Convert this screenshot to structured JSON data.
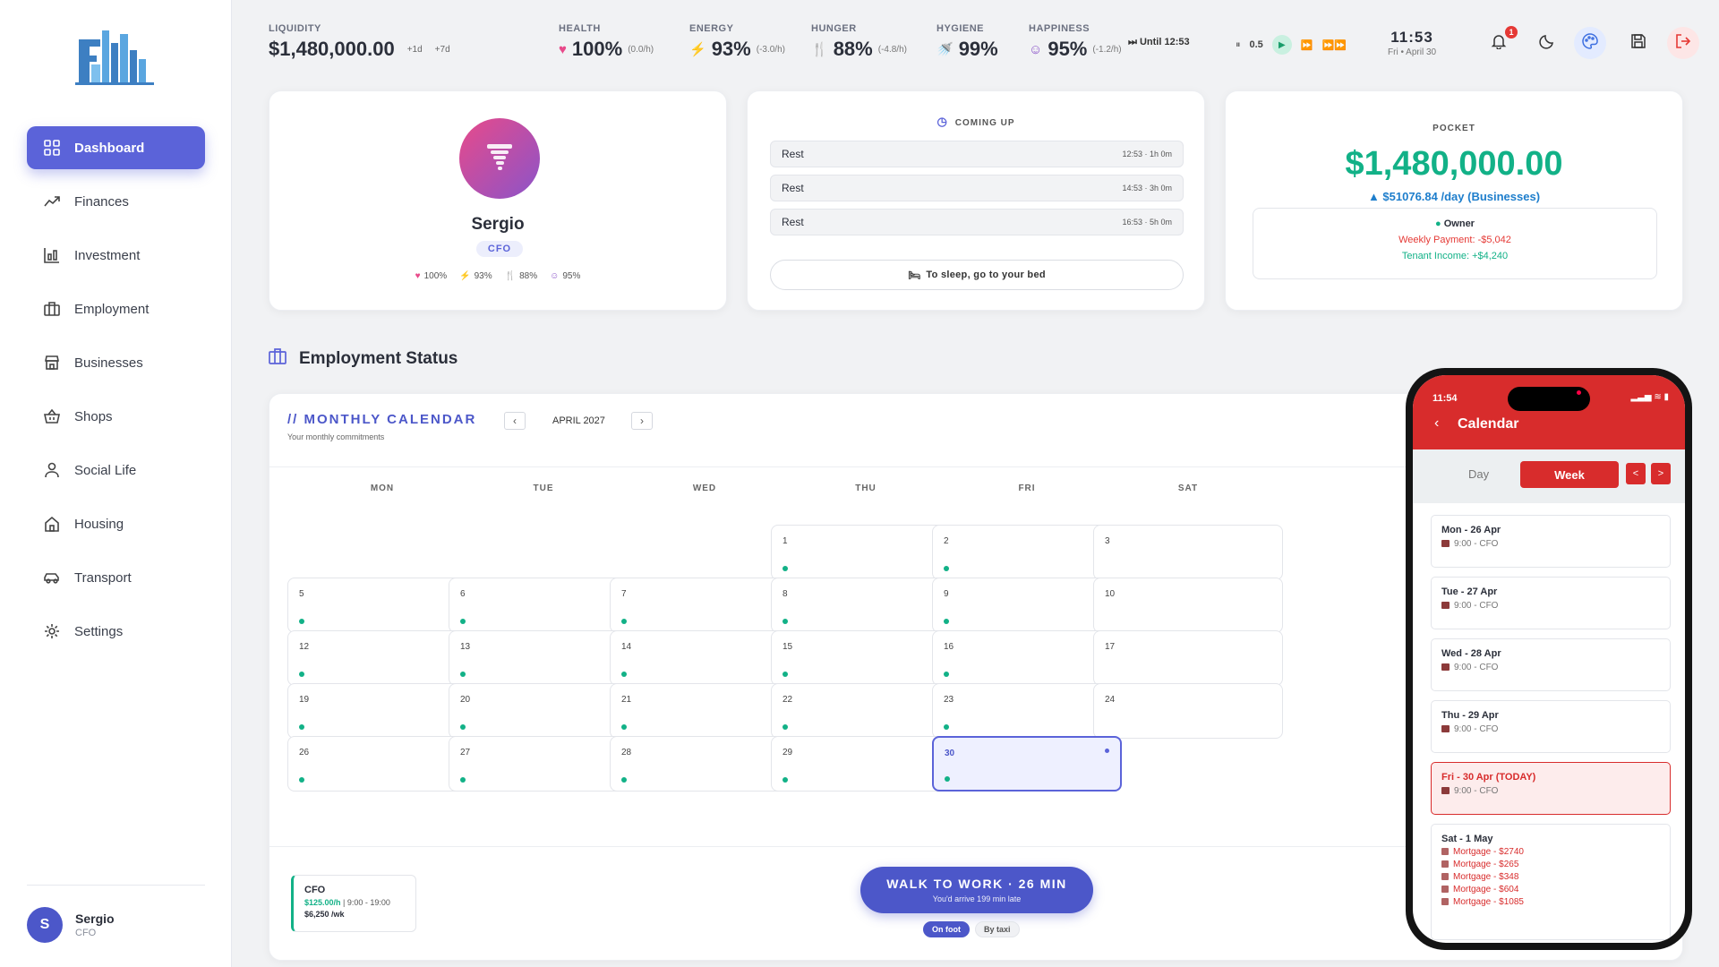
{
  "sidebar": {
    "items": [
      {
        "label": "Dashboard",
        "icon": "grid-icon"
      },
      {
        "label": "Finances",
        "icon": "trend-icon"
      },
      {
        "label": "Investment",
        "icon": "chart-icon"
      },
      {
        "label": "Employment",
        "icon": "briefcase-icon"
      },
      {
        "label": "Businesses",
        "icon": "store-icon"
      },
      {
        "label": "Shops",
        "icon": "basket-icon"
      },
      {
        "label": "Social Life",
        "icon": "person-icon"
      },
      {
        "label": "Housing",
        "icon": "home-icon"
      },
      {
        "label": "Transport",
        "icon": "car-icon"
      },
      {
        "label": "Settings",
        "icon": "gear-icon"
      }
    ],
    "user": {
      "initial": "S",
      "name": "Sergio",
      "role": "CFO"
    }
  },
  "topbar": {
    "liquidity": {
      "label": "LIQUIDITY",
      "value": "$1,480,000.00",
      "chip1": "+1d",
      "chip2": "+7d"
    },
    "health": {
      "label": "HEALTH",
      "value": "100%",
      "rate": "(0.0/h)"
    },
    "energy": {
      "label": "ENERGY",
      "value": "93%",
      "rate": "(-3.0/h)"
    },
    "hunger": {
      "label": "HUNGER",
      "value": "88%",
      "rate": "(-4.8/h)"
    },
    "hygiene": {
      "label": "HYGIENE",
      "value": "99%"
    },
    "happiness": {
      "label": "HAPPINESS",
      "value": "95%",
      "rate": "(-1.2/h)"
    },
    "until": "Until 12:53",
    "speed": "0.5",
    "time": "11:53",
    "date": "Fri • April 30",
    "notifications": "1"
  },
  "profile": {
    "name": "Sergio",
    "role": "CFO",
    "stats": [
      "100%",
      "93%",
      "88%",
      "95%"
    ]
  },
  "coming_up": {
    "title": "COMING UP",
    "items": [
      {
        "label": "Rest",
        "time": "12:53 · 1h 0m"
      },
      {
        "label": "Rest",
        "time": "14:53 · 3h 0m"
      },
      {
        "label": "Rest",
        "time": "16:53 · 5h 0m"
      }
    ],
    "sleep_button": "To sleep, go to your bed"
  },
  "pocket": {
    "label": "POCKET",
    "value": "$1,480,000.00",
    "per_day": "▲ $51076.84 /day (Businesses)",
    "owner": "Owner",
    "weekly_payment": "Weekly Payment: -$5,042",
    "tenant_income": "Tenant Income: +$4,240"
  },
  "employment": {
    "section_title": "Employment Status",
    "calendar_title": "// MONTHLY CALENDAR",
    "calendar_subtitle": "Your monthly commitments",
    "month": "APRIL 2027",
    "weekdays": [
      "MON",
      "TUE",
      "WED",
      "THU",
      "FRI",
      "SAT"
    ],
    "job": {
      "title": "CFO",
      "rate": "$125.00/h",
      "hours": " | 9:00 - 19:00",
      "weekly": "$6,250 /wk"
    },
    "walk_button": "WALK TO WORK · 26 MIN",
    "walk_sub": "You'd arrive 199 min late",
    "modes": [
      "On foot",
      "By taxi"
    ]
  },
  "calendar_days": [
    {
      "n": "1",
      "col": 3,
      "row": 0,
      "dot": true
    },
    {
      "n": "2",
      "col": 4,
      "row": 0,
      "dot": true
    },
    {
      "n": "3",
      "col": 5,
      "row": 0,
      "dot": false
    },
    {
      "n": "5",
      "col": 0,
      "row": 1,
      "dot": true
    },
    {
      "n": "6",
      "col": 1,
      "row": 1,
      "dot": true
    },
    {
      "n": "7",
      "col": 2,
      "row": 1,
      "dot": true
    },
    {
      "n": "8",
      "col": 3,
      "row": 1,
      "dot": true
    },
    {
      "n": "9",
      "col": 4,
      "row": 1,
      "dot": true
    },
    {
      "n": "10",
      "col": 5,
      "row": 1,
      "dot": false
    },
    {
      "n": "12",
      "col": 0,
      "row": 2,
      "dot": true
    },
    {
      "n": "13",
      "col": 1,
      "row": 2,
      "dot": true
    },
    {
      "n": "14",
      "col": 2,
      "row": 2,
      "dot": true
    },
    {
      "n": "15",
      "col": 3,
      "row": 2,
      "dot": true
    },
    {
      "n": "16",
      "col": 4,
      "row": 2,
      "dot": true
    },
    {
      "n": "17",
      "col": 5,
      "row": 2,
      "dot": false
    },
    {
      "n": "19",
      "col": 0,
      "row": 3,
      "dot": true
    },
    {
      "n": "20",
      "col": 1,
      "row": 3,
      "dot": true
    },
    {
      "n": "21",
      "col": 2,
      "row": 3,
      "dot": true
    },
    {
      "n": "22",
      "col": 3,
      "row": 3,
      "dot": true
    },
    {
      "n": "23",
      "col": 4,
      "row": 3,
      "dot": true
    },
    {
      "n": "24",
      "col": 5,
      "row": 3,
      "dot": false
    },
    {
      "n": "26",
      "col": 0,
      "row": 4,
      "dot": true
    },
    {
      "n": "27",
      "col": 1,
      "row": 4,
      "dot": true
    },
    {
      "n": "28",
      "col": 2,
      "row": 4,
      "dot": true
    },
    {
      "n": "29",
      "col": 3,
      "row": 4,
      "dot": true
    },
    {
      "n": "30",
      "col": 4,
      "row": 4,
      "dot": true,
      "today": true
    }
  ],
  "phone": {
    "time": "11:54",
    "title": "Calendar",
    "tab_day": "Day",
    "tab_week": "Week",
    "days": [
      {
        "header": "Mon - 26 Apr",
        "event": "9:00 - CFO"
      },
      {
        "header": "Tue - 27 Apr",
        "event": "9:00 - CFO"
      },
      {
        "header": "Wed - 28 Apr",
        "event": "9:00 - CFO"
      },
      {
        "header": "Thu - 29 Apr",
        "event": "9:00 - CFO"
      },
      {
        "header": "Fri - 30 Apr (TODAY)",
        "event": "9:00 - CFO"
      }
    ],
    "sat": {
      "header": "Sat - 1 May",
      "items": [
        "Mortgage - $2740",
        "Mortgage - $265",
        "Mortgage - $348",
        "Mortgage - $604",
        "Mortgage - $1085"
      ]
    }
  },
  "colors": {
    "accent": "#5b63d9",
    "green": "#12b187",
    "red": "#d82c2c",
    "blue": "#1e7ecc"
  }
}
